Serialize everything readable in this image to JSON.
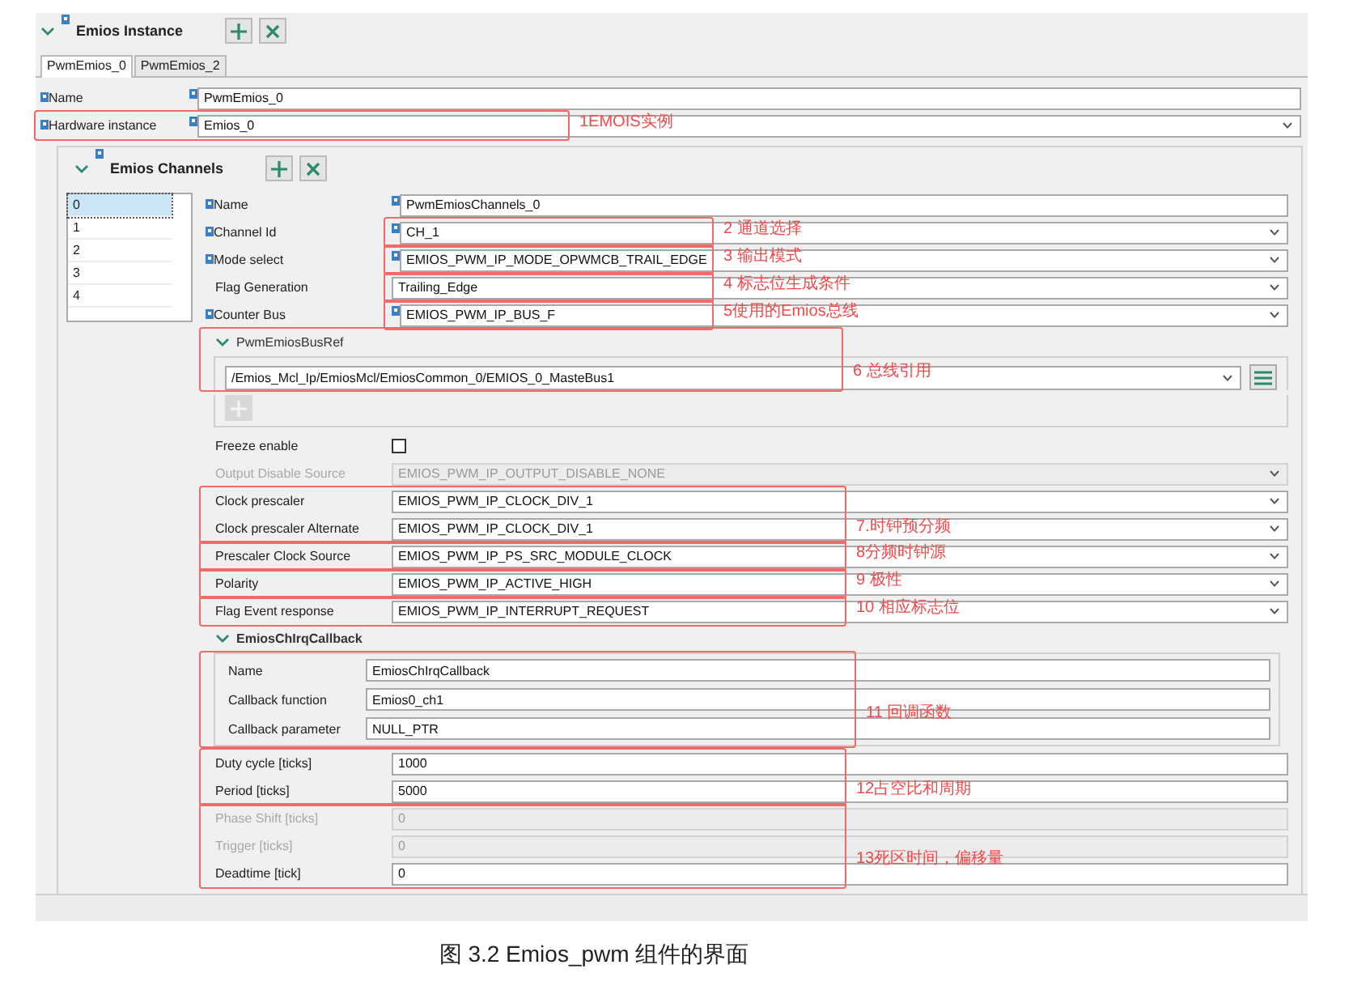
{
  "instance": {
    "title": "Emios Instance"
  },
  "tabs": [
    {
      "label": "PwmEmios_0",
      "selected": true
    },
    {
      "label": "PwmEmios_2",
      "selected": false
    }
  ],
  "instance_fields": [
    {
      "kind": "text",
      "label": "Name",
      "value": "PwmEmios_0",
      "flagged": true
    },
    {
      "kind": "select",
      "label": "Hardware instance",
      "value": "Emios_0",
      "flagged": true,
      "note": {
        "kind": "row",
        "text": "1EMOIS实例"
      }
    }
  ],
  "channels": {
    "title": "Emios Channels",
    "list": [
      {
        "label": "0",
        "selected": true
      },
      {
        "label": "1",
        "selected": false
      },
      {
        "label": "2",
        "selected": false
      },
      {
        "label": "3",
        "selected": false
      },
      {
        "label": "4",
        "selected": false
      }
    ],
    "blocks": [
      {
        "kind": "fields",
        "rows": [
          {
            "kind": "text",
            "label": "Name",
            "value": "PwmEmiosChannels_0",
            "flagged": true
          }
        ]
      },
      {
        "kind": "fields",
        "note": {
          "kind": "field",
          "text": "2 通道选择"
        },
        "rows": [
          {
            "kind": "select",
            "label": "Channel Id",
            "value": "CH_1",
            "flagged": true
          }
        ]
      },
      {
        "kind": "fields",
        "note": {
          "kind": "field",
          "text": "3 输出模式"
        },
        "rows": [
          {
            "kind": "select",
            "label": "Mode select",
            "value": "EMIOS_PWM_IP_MODE_OPWMCB_TRAIL_EDGE",
            "flagged": true
          }
        ]
      },
      {
        "kind": "fields",
        "note": {
          "kind": "field",
          "text": "4 标志位生成条件"
        },
        "rows": [
          {
            "kind": "select",
            "label": "Flag Generation",
            "value": "Trailing_Edge"
          }
        ]
      },
      {
        "kind": "fields",
        "note": {
          "kind": "field",
          "text": "5使用的Emios总线"
        },
        "rows": [
          {
            "kind": "select",
            "label": "Counter Bus",
            "value": "EMIOS_PWM_IP_BUS_F",
            "flagged": true
          }
        ]
      },
      {
        "kind": "busref",
        "title": "PwmEmiosBusRef",
        "value": "/Emios_Mcl_Ip/EmiosMcl/EmiosCommon_0/EMIOS_0_MasteBus1",
        "note": {
          "kind": "row",
          "text": "6 总线引用"
        }
      },
      {
        "kind": "fields",
        "rows": [
          {
            "kind": "checkbox",
            "label": "Freeze enable",
            "checked": false
          },
          {
            "kind": "select",
            "label": "Output Disable Source",
            "value": "EMIOS_PWM_IP_OUTPUT_DISABLE_NONE",
            "disabled": true
          }
        ]
      },
      {
        "kind": "fields",
        "note": {
          "kind": "row",
          "text": "7.时钟预分频"
        },
        "rows": [
          {
            "kind": "select",
            "label": "Clock prescaler",
            "value": "EMIOS_PWM_IP_CLOCK_DIV_1"
          },
          {
            "kind": "select",
            "label": "Clock prescaler Alternate",
            "value": "EMIOS_PWM_IP_CLOCK_DIV_1"
          }
        ]
      },
      {
        "kind": "fields",
        "note": {
          "kind": "row",
          "text": "8分频时钟源"
        },
        "rows": [
          {
            "kind": "select",
            "label": "Prescaler Clock Source",
            "value": "EMIOS_PWM_IP_PS_SRC_MODULE_CLOCK"
          }
        ]
      },
      {
        "kind": "fields",
        "note": {
          "kind": "row",
          "text": "9 极性"
        },
        "rows": [
          {
            "kind": "select",
            "label": "Polarity",
            "value": "EMIOS_PWM_IP_ACTIVE_HIGH"
          }
        ]
      },
      {
        "kind": "fields",
        "note": {
          "kind": "row",
          "text": "10 相应标志位"
        },
        "rows": [
          {
            "kind": "select",
            "label": "Flag Event response",
            "value": "EMIOS_PWM_IP_INTERRUPT_REQUEST"
          }
        ]
      },
      {
        "kind": "callback",
        "title": "EmiosChIrqCallback",
        "note": {
          "kind": "row",
          "text": "11 回调函数"
        },
        "rows": [
          {
            "kind": "text",
            "label": "Name",
            "value": "EmiosChIrqCallback"
          },
          {
            "kind": "text",
            "label": "Callback function",
            "value": "Emios0_ch1"
          },
          {
            "kind": "text",
            "label": "Callback parameter",
            "value": "NULL_PTR"
          }
        ]
      },
      {
        "kind": "fields",
        "note": {
          "kind": "row",
          "text": "12占空比和周期"
        },
        "rows": [
          {
            "kind": "text",
            "label": "Duty cycle [ticks]",
            "value": "1000"
          },
          {
            "kind": "text",
            "label": "Period [ticks]",
            "value": "5000"
          }
        ]
      },
      {
        "kind": "fields",
        "note": {
          "kind": "row",
          "text": "13死区时间，偏移量"
        },
        "rows": [
          {
            "kind": "text",
            "label": "Phase Shift [ticks]",
            "value": "0",
            "disabled": true
          },
          {
            "kind": "text",
            "label": "Trigger [ticks]",
            "value": "0",
            "disabled": true
          },
          {
            "kind": "text",
            "label": "Deadtime [tick]",
            "value": "0"
          }
        ]
      }
    ]
  },
  "caption": "图  3.2 Emios_pwm 组件的界面"
}
